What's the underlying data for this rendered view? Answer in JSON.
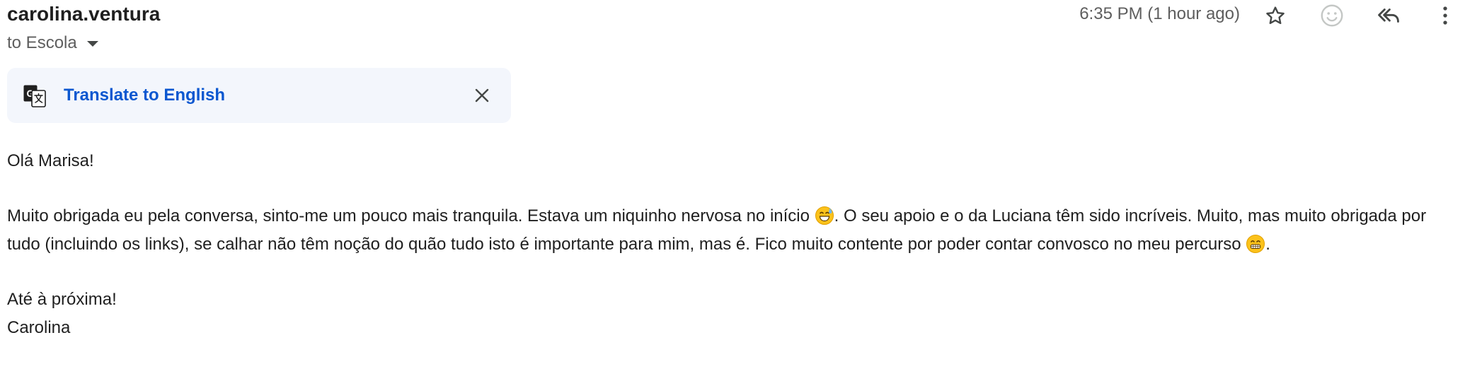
{
  "header": {
    "sender": "carolina.ventura",
    "recipient_label": "to Escola",
    "timestamp": "6:35 PM (1 hour ago)",
    "icons": {
      "star": "star-icon",
      "reaction": "add-reaction-icon",
      "reply_all": "reply-all-icon",
      "more": "more-vert-icon"
    }
  },
  "translate": {
    "link_label": "Translate to English",
    "icon": "translate-icon",
    "close_icon": "close-icon",
    "background": "#f3f6fc",
    "link_color": "#0b57d0"
  },
  "message": {
    "greeting": "Olá Marisa!",
    "paragraph_part1": "Muito obrigada eu pela conversa, sinto-me um pouco mais tranquila. Estava um niquinho nervosa no início ",
    "emoji1": "grinning-face-with-sweat-emoji",
    "paragraph_part2": ". O seu apoio e o da Luciana têm sido incríveis. Muito, mas muito obrigada por tudo (incluindo os links), se calhar não têm noção do quão tudo isto é importante para mim, mas é. Fico muito contente por poder contar convosco no meu percurso ",
    "emoji2": "grimacing-face-emoji",
    "paragraph_part3": ".",
    "closing": "Até à próxima!",
    "signature": "Carolina"
  }
}
